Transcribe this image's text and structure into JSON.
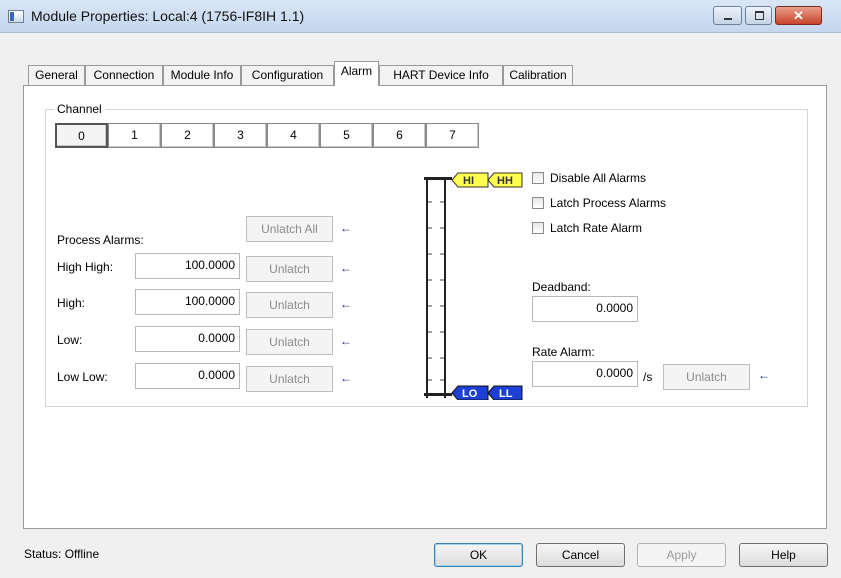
{
  "window": {
    "title": "Module Properties: Local:4 (1756-IF8IH 1.1)",
    "close_glyph": "✕"
  },
  "tabs": [
    {
      "label": "General"
    },
    {
      "label": "Connection"
    },
    {
      "label": "Module Info"
    },
    {
      "label": "Configuration"
    },
    {
      "label": "Alarm",
      "active": true
    },
    {
      "label": "HART Device Info"
    },
    {
      "label": "Calibration"
    }
  ],
  "channel": {
    "legend": "Channel",
    "buttons": [
      "0",
      "1",
      "2",
      "3",
      "4",
      "5",
      "6",
      "7"
    ],
    "selected": "0"
  },
  "process_alarms": {
    "heading": "Process Alarms:",
    "unlatch_all_label": "Unlatch All",
    "rows": [
      {
        "label": "High High:",
        "value": "100.0000",
        "button": "Unlatch"
      },
      {
        "label": "High:",
        "value": "100.0000",
        "button": "Unlatch"
      },
      {
        "label": "Low:",
        "value": "0.0000",
        "button": "Unlatch"
      },
      {
        "label": "Low Low:",
        "value": "0.0000",
        "button": "Unlatch"
      }
    ],
    "arrow_glyph": "←"
  },
  "scale": {
    "high_markers": [
      "HI",
      "HH"
    ],
    "low_markers": [
      "LO",
      "LL"
    ],
    "colors": {
      "high": "#ffff4d",
      "low": "#1c3fd6"
    }
  },
  "options": {
    "disable_all": "Disable All Alarms",
    "latch_process": "Latch Process Alarms",
    "latch_rate": "Latch Rate Alarm"
  },
  "deadband": {
    "label": "Deadband:",
    "value": "0.0000"
  },
  "rate_alarm": {
    "label": "Rate Alarm:",
    "value": "0.0000",
    "unit": "/s",
    "button": "Unlatch"
  },
  "status": {
    "text": "Status:  Offline"
  },
  "buttons": {
    "ok": "OK",
    "cancel": "Cancel",
    "apply": "Apply",
    "help": "Help"
  }
}
